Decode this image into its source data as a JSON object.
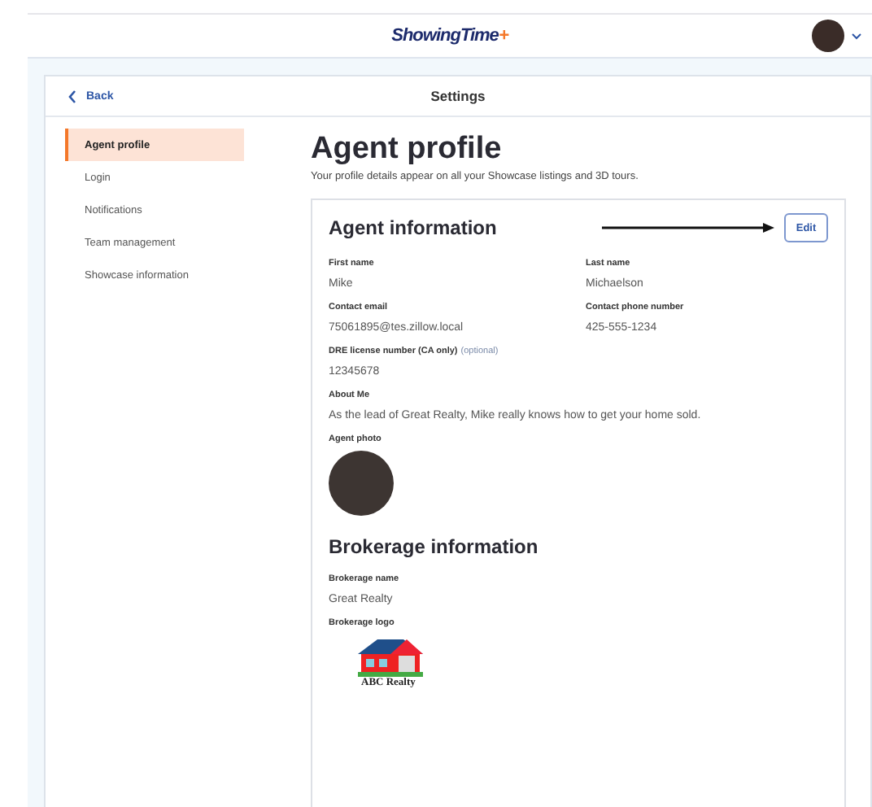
{
  "header": {
    "brand": "ShowingTime",
    "brand_mark": "+"
  },
  "settings": {
    "back": "Back",
    "title": "Settings"
  },
  "sidebar": {
    "items": [
      {
        "label": "Agent profile",
        "selected": true
      },
      {
        "label": "Login",
        "selected": false
      },
      {
        "label": "Notifications",
        "selected": false
      },
      {
        "label": "Team management",
        "selected": false
      },
      {
        "label": "Showcase information",
        "selected": false
      }
    ]
  },
  "page": {
    "title": "Agent profile",
    "subtitle": "Your profile details appear on all your Showcase listings and 3D tours."
  },
  "agent_information": {
    "title": "Agent information",
    "edit": "Edit",
    "rows": [
      [
        {
          "label": "First name",
          "value": "Mike"
        },
        {
          "label": "Last name",
          "value": "Michaelson"
        }
      ],
      [
        {
          "label": "Contact email",
          "value": "75061895@tes.zillow.local"
        },
        {
          "label": "Contact phone number",
          "value": "425-555-1234"
        }
      ],
      [
        {
          "label": "DRE license number (CA only)",
          "hint": "(optional)",
          "value": "12345678"
        }
      ],
      [
        {
          "label": "About Me",
          "value": "As the lead of Great Realty, Mike really knows how to get your home sold."
        }
      ]
    ],
    "photo_label": "Agent photo"
  },
  "brokerage_information": {
    "title": "Brokerage information",
    "name_label": "Brokerage name",
    "name": "Great Realty",
    "logo_label": "Brokerage logo",
    "logo_text": "ABC Realty"
  }
}
